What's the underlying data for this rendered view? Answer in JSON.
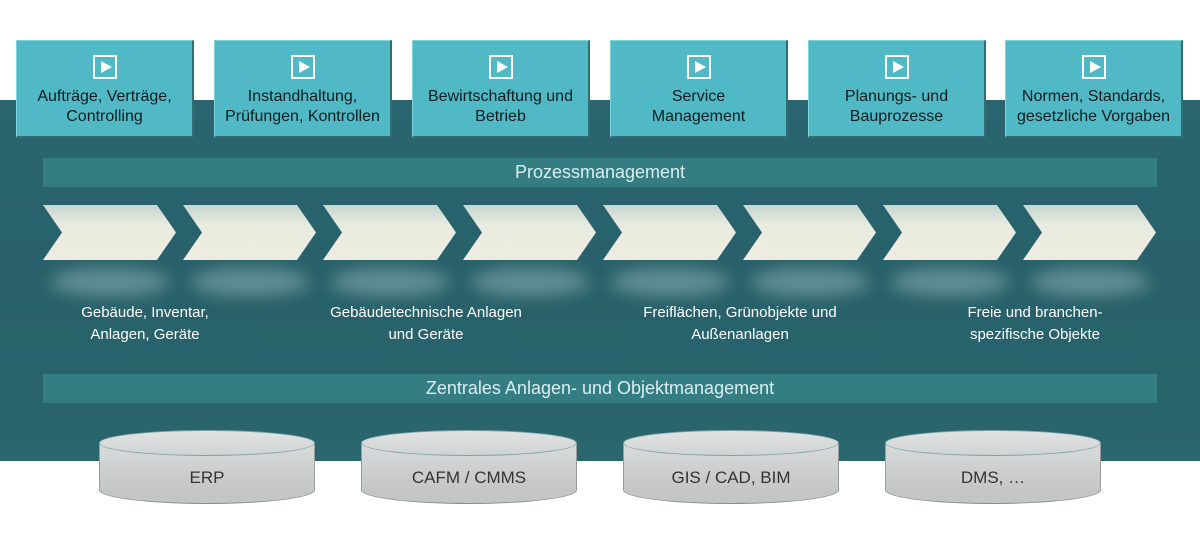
{
  "process_areas": [
    {
      "label": "Aufträge, Verträge,\nControlling",
      "icon": "play-icon"
    },
    {
      "label": "Instandhaltung,\nPrüfungen, Kontrollen",
      "icon": "play-icon"
    },
    {
      "label": "Bewirtschaftung und\nBetrieb",
      "icon": "play-icon"
    },
    {
      "label": "Service\nManagement",
      "icon": "play-icon"
    },
    {
      "label": "Planungs- und\nBauprozesse",
      "icon": "play-icon"
    },
    {
      "label": "Normen, Standards,\ngesetzliche Vorgaben",
      "icon": "play-icon"
    }
  ],
  "process_bar": {
    "label": "Prozessmanagement"
  },
  "chevron_count": 8,
  "object_categories": [
    {
      "label": "Gebäude, Inventar,\nAnlagen, Geräte"
    },
    {
      "label": "Gebäudetechnische Anlagen\nund Geräte"
    },
    {
      "label": "Freiflächen, Grünobjekte und\nAußenanlagen"
    },
    {
      "label": "Freie  und  branchen-\nspezifische Objekte"
    }
  ],
  "object_bar": {
    "label": "Zentrales Anlagen- und Objektmanagement"
  },
  "systems": [
    {
      "label": "ERP"
    },
    {
      "label": "CAFM / CMMS"
    },
    {
      "label": "GIS / CAD, BIM"
    },
    {
      "label": "DMS, …"
    }
  ],
  "colors": {
    "band": "#27606a",
    "box": "#50b9c5",
    "bar": "#337d83",
    "chevron": "#efede2",
    "database": "#c4c6c6"
  }
}
